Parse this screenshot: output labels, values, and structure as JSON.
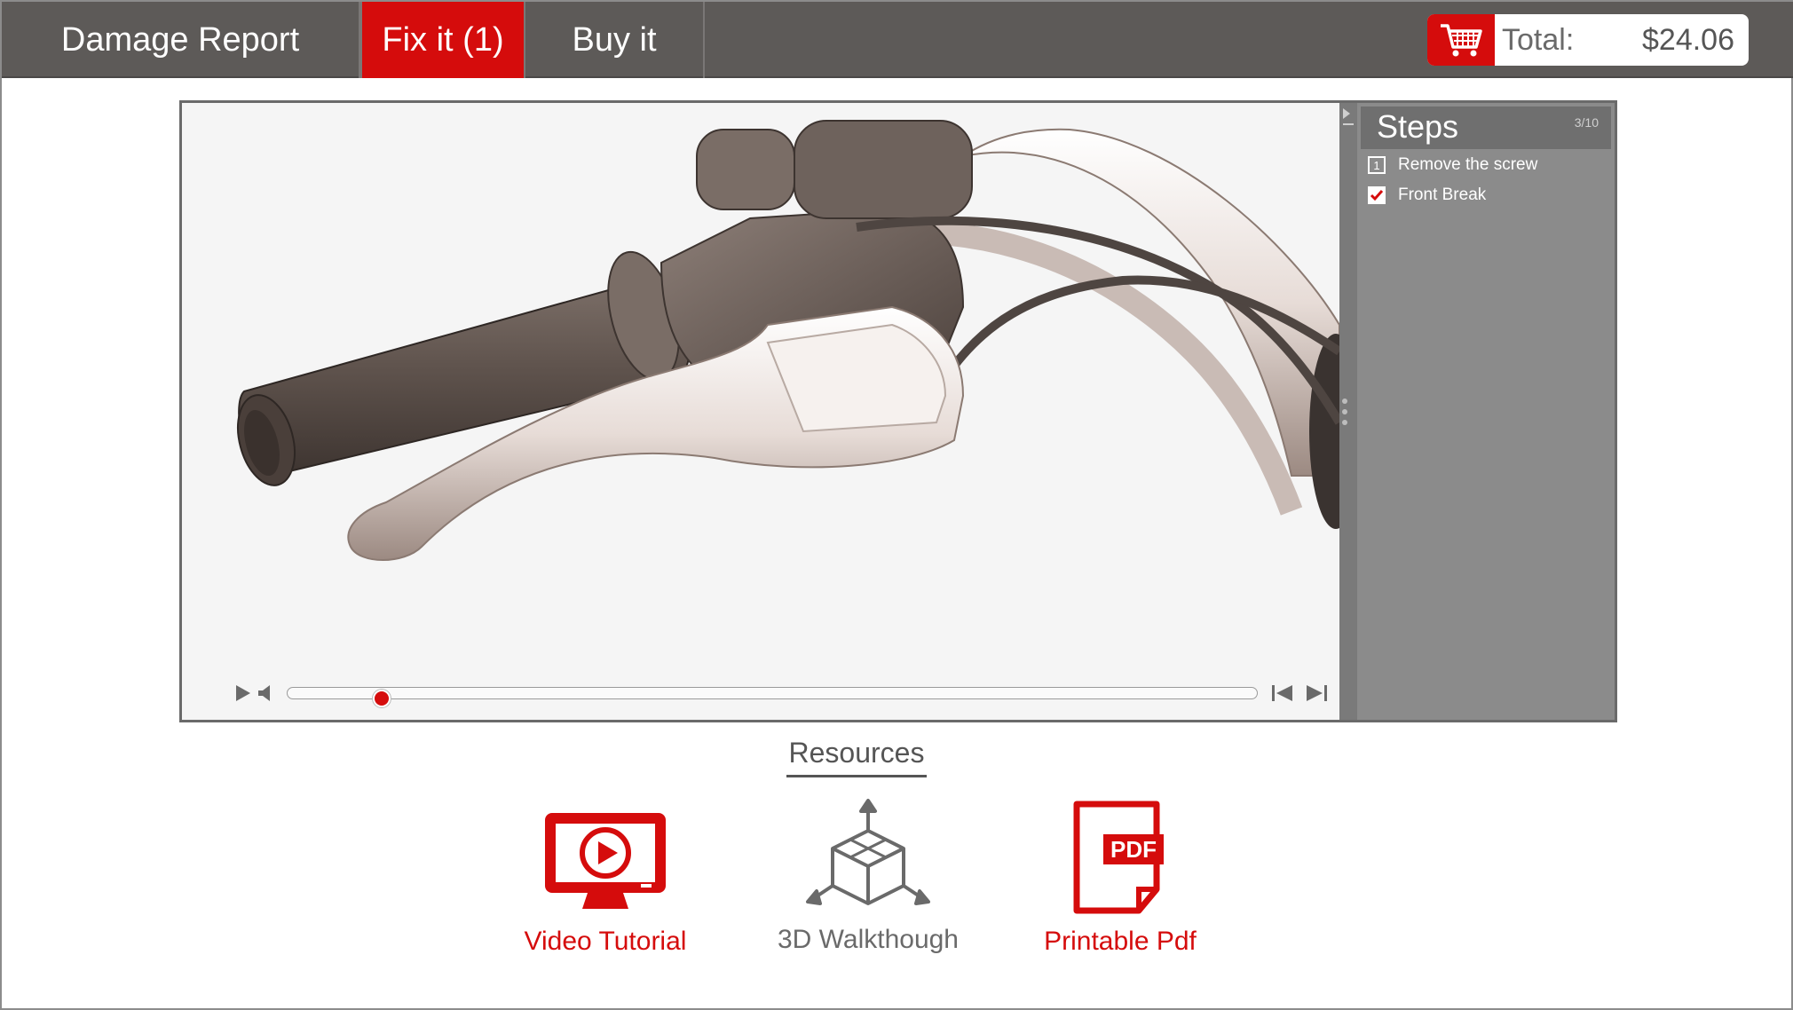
{
  "nav": {
    "tabs": [
      {
        "label": "Damage Report",
        "active": false
      },
      {
        "label": "Fix it (1)",
        "active": true
      },
      {
        "label": "Buy it",
        "active": false
      }
    ]
  },
  "cart": {
    "label": "Total:",
    "total": "$24.06",
    "icon": "shopping-cart-icon"
  },
  "player": {
    "progress": 0.09,
    "controls": [
      "play-icon",
      "volume-icon",
      "skip-back-icon",
      "skip-forward-icon"
    ]
  },
  "steps": {
    "title": "Steps",
    "count": "3/10",
    "items": [
      {
        "number": "1",
        "label": "Remove the screw",
        "checked": false
      },
      {
        "number": "",
        "label": "Front Break",
        "checked": true
      }
    ]
  },
  "resources": {
    "title": "Resources",
    "items": [
      {
        "label": "Video Tutorial",
        "icon": "video-tutorial-icon",
        "color": "#d50c0c"
      },
      {
        "label": "3D Walkthough",
        "icon": "3d-cube-icon",
        "color": "#6a6a6a"
      },
      {
        "label": "Printable Pdf",
        "icon": "pdf-icon",
        "color": "#d50c0c"
      }
    ]
  },
  "colors": {
    "accent": "#d50c0c",
    "topbar": "#5d5a58",
    "panel": "#8b8b8b"
  }
}
